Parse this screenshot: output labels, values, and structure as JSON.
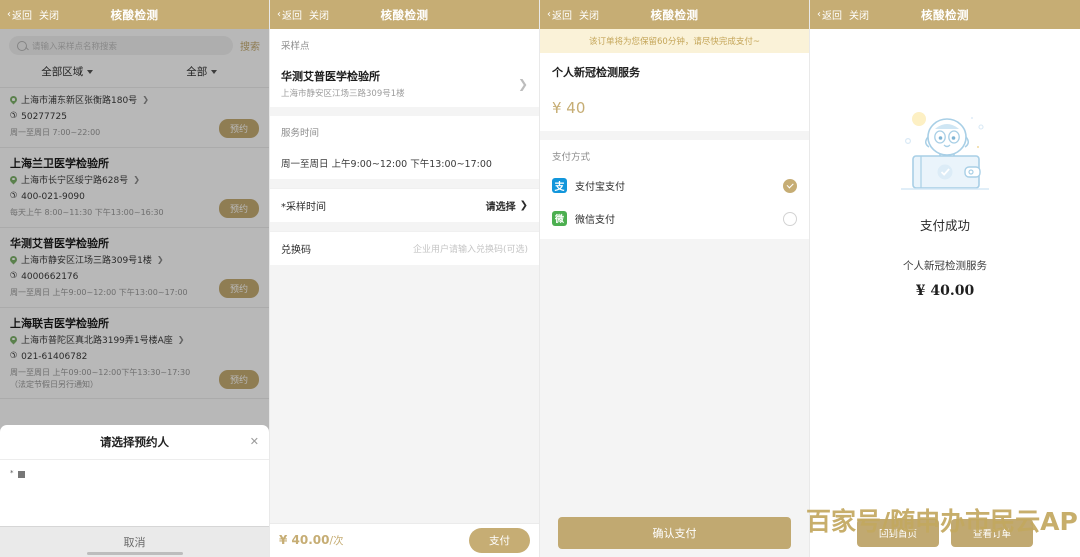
{
  "nav": {
    "back": "返回",
    "close": "关闭",
    "title": "核酸检测",
    "chevron": "‹"
  },
  "panel1": {
    "search": {
      "placeholder": "请输入采样点名称搜索",
      "button": "搜索",
      "icon": "search-icon"
    },
    "filters": [
      {
        "label": "全部区域"
      },
      {
        "label": "全部"
      }
    ],
    "sites": [
      {
        "name": "",
        "address": "上海市浦东新区张衡路180号",
        "phone": "50277725",
        "hours": "周一至周日 7:00~22:00",
        "book": "预约"
      },
      {
        "name": "上海兰卫医学检验所",
        "address": "上海市长宁区绥宁路628号",
        "phone": "400-021-9090",
        "hours": "每天上午 8:00~11:30 下午13:00~16:30",
        "book": "预约"
      },
      {
        "name": "华测艾普医学检验所",
        "address": "上海市静安区江场三路309号1楼",
        "phone": "4000662176",
        "hours": "周一至周日 上午9:00~12:00 下午13:00~17:00",
        "book": "预约"
      },
      {
        "name": "上海联吉医学检验所",
        "address": "上海市普陀区真北路3199弄1号楼A座",
        "phone": "021-61406782",
        "hours": "周一至周日 上午09:00~12:00下午13:30~17:30（法定节假日另行通知）",
        "book": "预约"
      }
    ],
    "sheet": {
      "title": "请选择预约人",
      "close_icon": "close-icon",
      "person_mask": "*",
      "cancel": "取消"
    }
  },
  "panel2": {
    "section_site": "采样点",
    "site": {
      "name": "华测艾普医学检验所",
      "address": "上海市静安区江场三路309号1楼"
    },
    "section_service_time": "服务时间",
    "service_time": "周一至周日 上午9:00~12:00 下午13:00~17:00",
    "sample_time": {
      "label": "采样时间",
      "required": "*",
      "value": "请选择"
    },
    "coupon": {
      "label": "兑换码",
      "placeholder": "企业用户请输入兑换码(可选)"
    },
    "footer": {
      "price": "¥ 40.00",
      "unit": "/次",
      "pay": "支付"
    }
  },
  "panel3": {
    "notice": "该订单将为您保留60分钟，请尽快完成支付~",
    "service_name": "个人新冠检测服务",
    "price": "¥ 40",
    "pay_section": "支付方式",
    "methods": [
      {
        "name": "支付宝支付",
        "icon": "alipay-icon",
        "glyph": "支",
        "selected": true,
        "color": "#1296db"
      },
      {
        "name": "微信支付",
        "icon": "wechat-icon",
        "glyph": "微",
        "selected": false,
        "color": "#4caf50"
      }
    ],
    "confirm": "确认支付"
  },
  "panel4": {
    "illustration": "wallet-penguin-illustration",
    "status": "支付成功",
    "service_name": "个人新冠检测服务",
    "amount": "¥ 40.00",
    "buttons": [
      {
        "label": "回到首页"
      },
      {
        "label": "查看订单"
      }
    ]
  },
  "watermark": {
    "text": "百家号/随申办市民云APP",
    "color": "#c3a85f"
  }
}
